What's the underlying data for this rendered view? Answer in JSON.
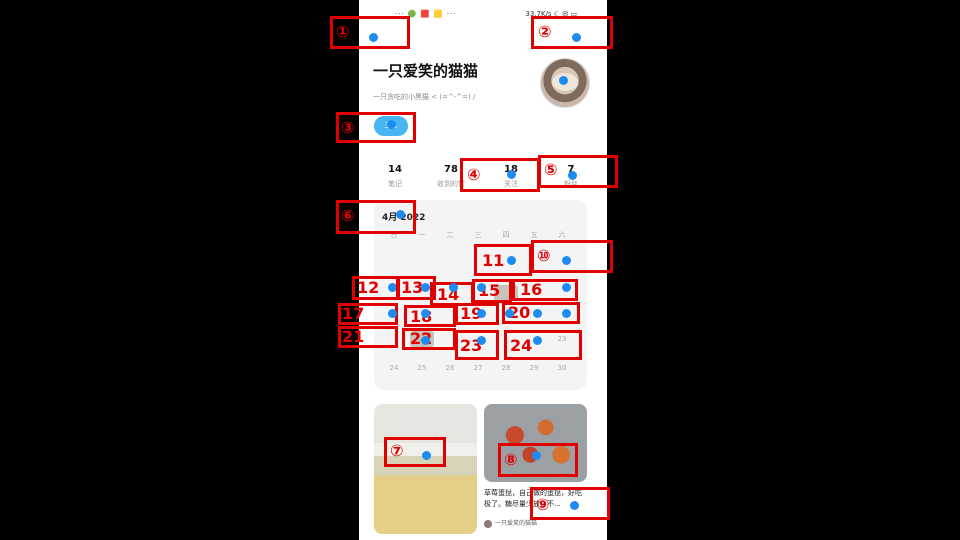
{
  "status_bar": {
    "left_text": "··· 🟢 🟥 🟨 ···",
    "right_text": "33.7K/s ☾ ✉ ▭"
  },
  "profile": {
    "name": "一只爱笑的猫猫",
    "bio": "一只贪吃的小黑猫 < (=^-^=) /",
    "tag": "3 1"
  },
  "stats": [
    {
      "num": "14",
      "label": "笔记"
    },
    {
      "num": "78",
      "label": "收到的赞"
    },
    {
      "num": "18",
      "label": "关注"
    },
    {
      "num": "7",
      "label": "粉丝"
    }
  ],
  "calendar": {
    "title": "4月 2022",
    "weekdays": [
      "日",
      "一",
      "二",
      "三",
      "四",
      "五",
      "六"
    ],
    "last_row": [
      "24",
      "25",
      "26",
      "27",
      "28",
      "29",
      "30"
    ],
    "visible_day": "23"
  },
  "note": {
    "caption": "草莓蛋挞，自己做的蛋挞，好吃极了。糖尽量少放，不...",
    "author": "一只爱笑的猫猫"
  },
  "annotations": [
    "①",
    "②",
    "③",
    "④",
    "⑤",
    "⑥",
    "⑦",
    "⑧",
    "⑨",
    "⑩",
    "11",
    "12",
    "13",
    "14",
    "15",
    "16",
    "17",
    "18",
    "19",
    "20",
    "21",
    "22",
    "23",
    "24"
  ]
}
